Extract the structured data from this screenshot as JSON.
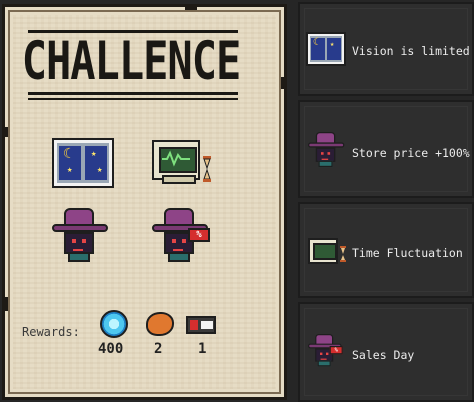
{
  "title": "CHALLENCE",
  "rewards": {
    "label": "Rewards:",
    "items": [
      {
        "name": "gem",
        "value": "400"
      },
      {
        "name": "cookie",
        "value": "2"
      },
      {
        "name": "card",
        "value": "1"
      }
    ]
  },
  "modifiers": [
    {
      "label": "Vision is limited",
      "icon": "night-window-icon"
    },
    {
      "label": "Store price +100%",
      "icon": "witch-hat-monster-icon"
    },
    {
      "label": "Time Fluctuation",
      "icon": "computer-monitor-icon"
    },
    {
      "label": "Sales Day",
      "icon": "sale-sign-monster-icon"
    }
  ],
  "sale_sign_text": "%",
  "colors": {
    "parchment": "#e6dcc5",
    "card_bg": "#2e2e2e",
    "text_light": "#ececec",
    "text_dark": "#1a1814"
  }
}
